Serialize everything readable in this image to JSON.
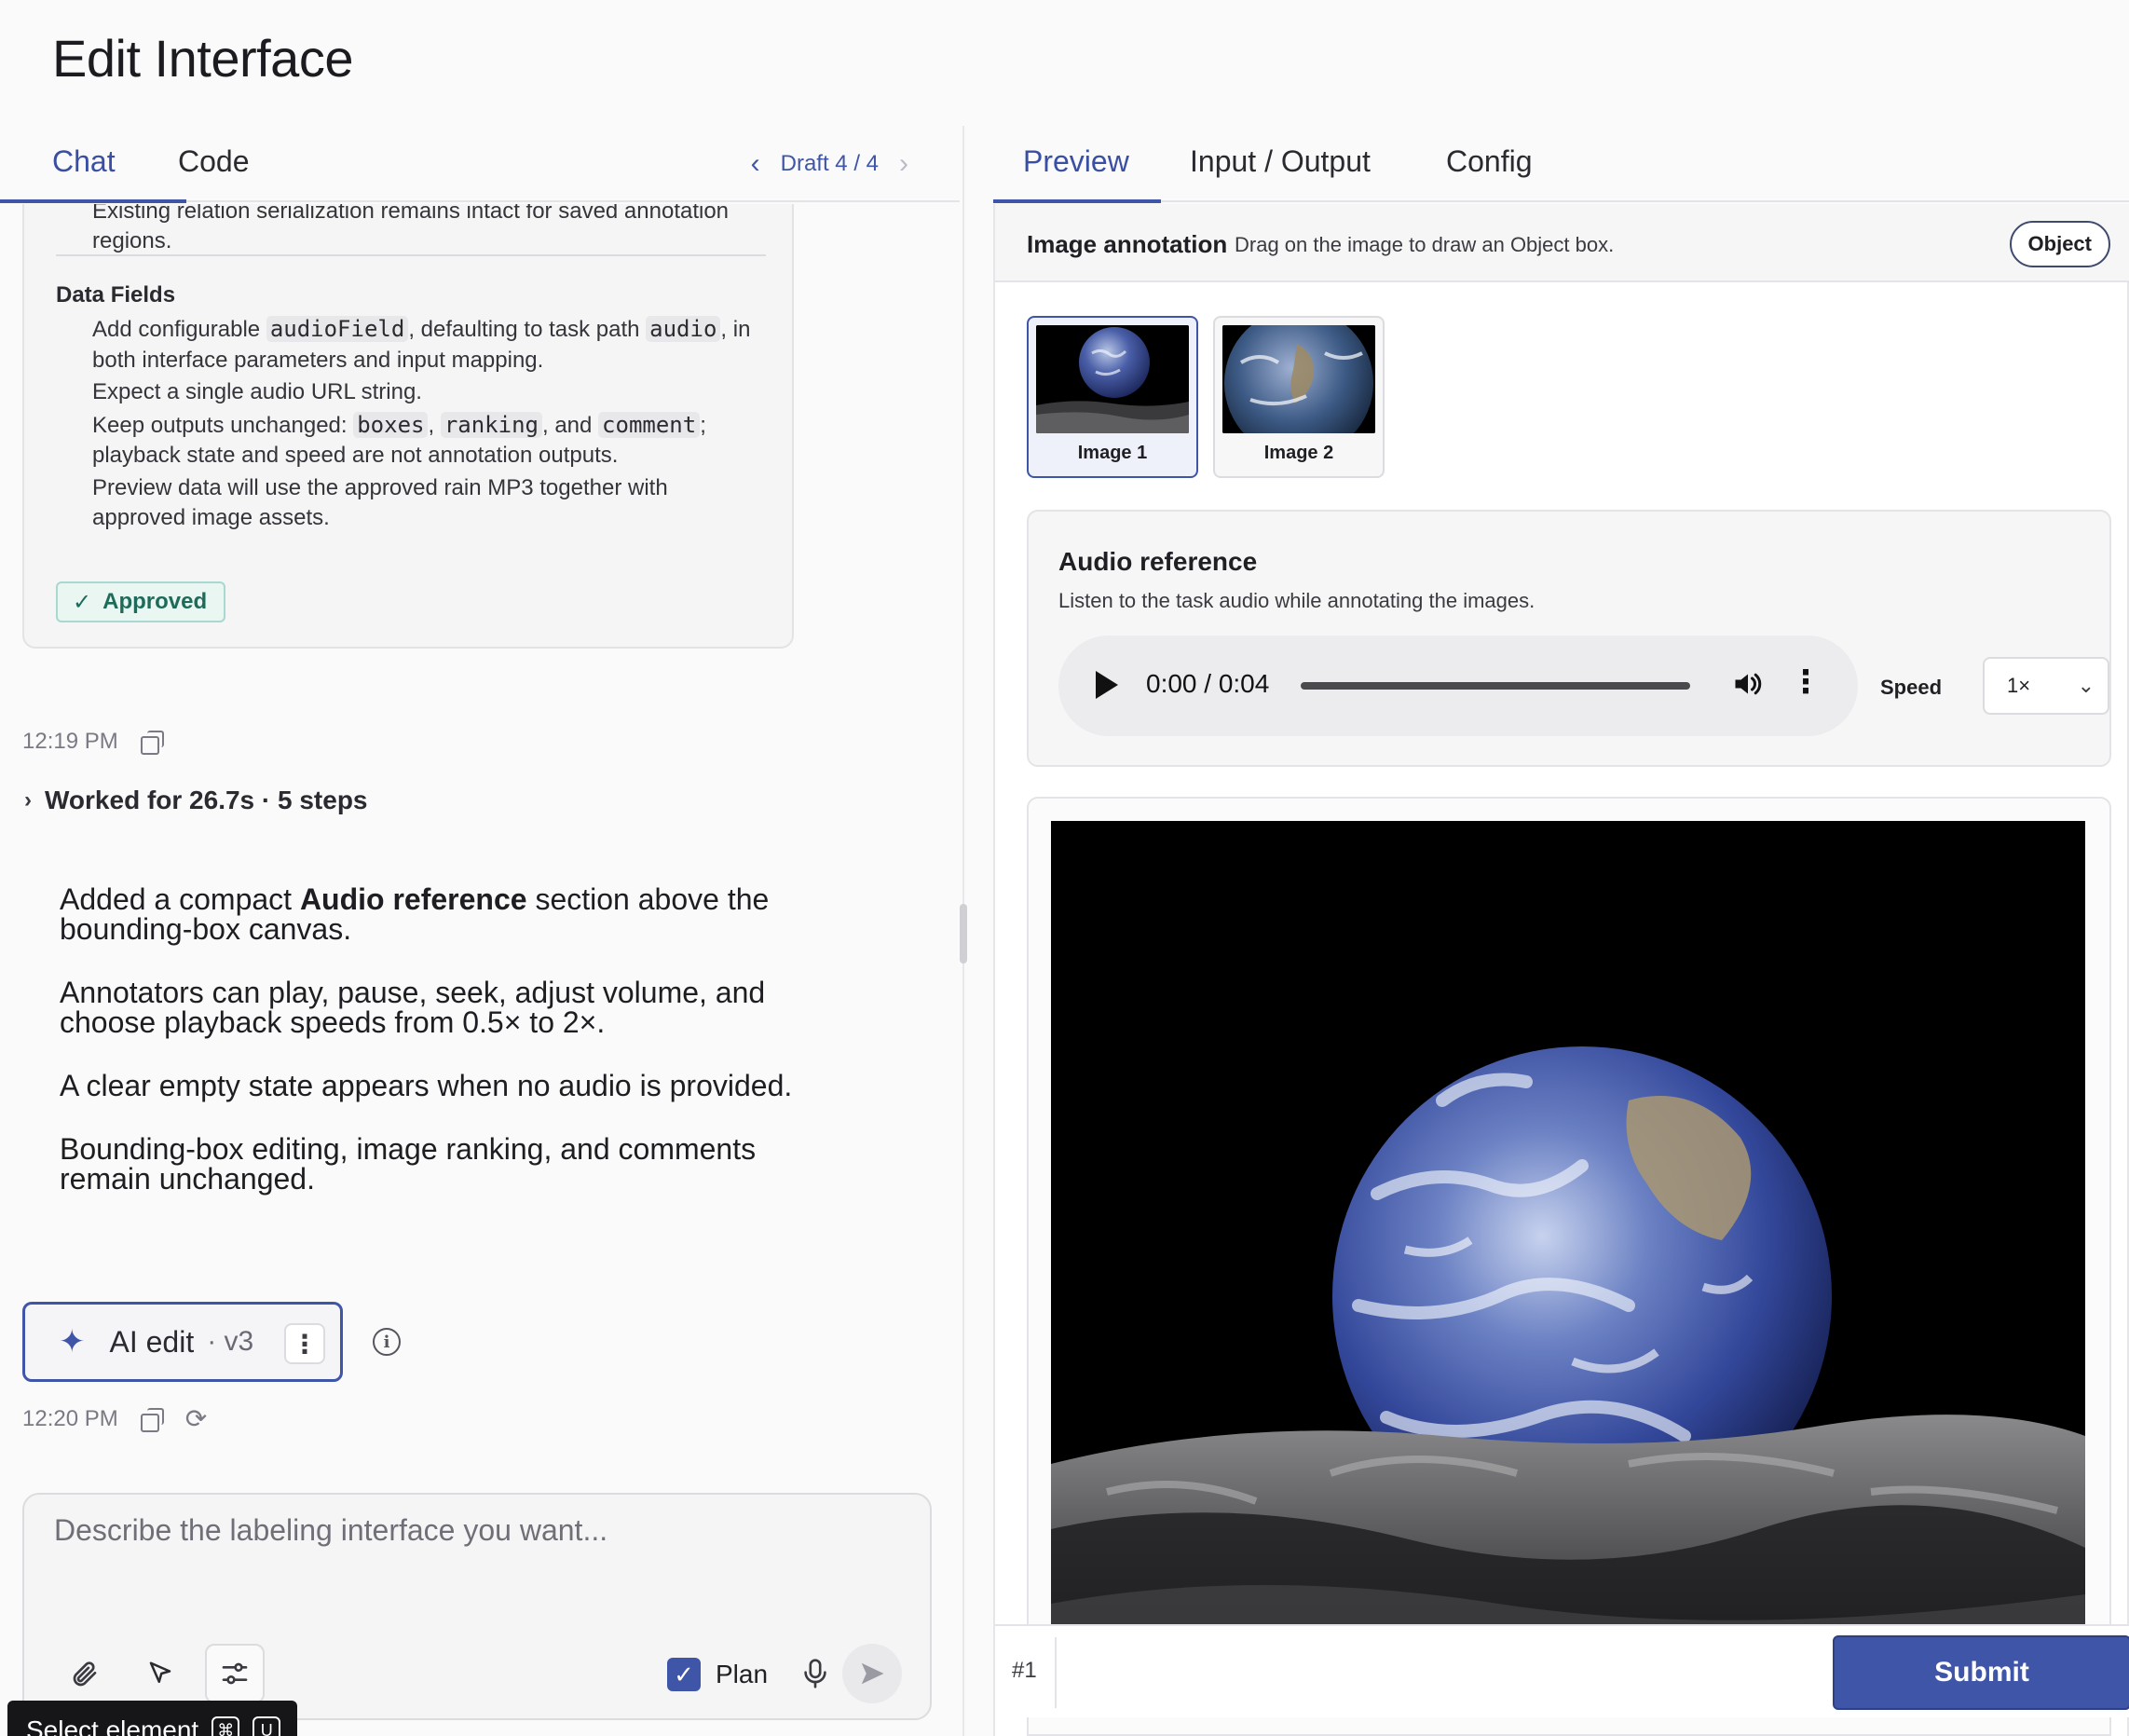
{
  "app": {
    "title": "Edit Interface"
  },
  "left_tabs": {
    "chat": "Chat",
    "code": "Code",
    "draft": "Draft 4 / 4",
    "prev_icon": "chevron-left-icon",
    "next_icon": "chevron-right-icon"
  },
  "plan_card": {
    "top_text": "Existing relation serialization remains intact for saved annotation regions.",
    "section_title": "Data Fields",
    "bullets": {
      "b1_pre": "Add configurable",
      "b1_code1": "audioField",
      "b1_mid": ", defaulting to task path",
      "b1_code2": "audio",
      "b1_post": ", in both interface parameters and input mapping.",
      "b2": "Expect a single audio URL string.",
      "b3_pre": "Keep outputs unchanged:",
      "b3_code1": "boxes",
      "b3_sep": ",",
      "b3_code2": "ranking",
      "b3_and": ", and",
      "b3_code3": "comment",
      "b3_post": "; playback state and speed are not annotation outputs.",
      "b4": "Preview data will use the approved rain MP3 together with approved image assets."
    },
    "approved_label": "Approved"
  },
  "messages": {
    "time_1": "12:19 PM",
    "worked": "Worked for 26.7s · 5 steps",
    "summary_p1_pre": "Added a compact ",
    "summary_p1_bold": "Audio reference",
    "summary_p1_post": " section above the bounding-box canvas.",
    "summary_p2": "Annotators can play, pause, seek, adjust volume, and choose playback speeds from 0.5× to 2×.",
    "summary_p3": "A clear empty state appears when no audio is provided.",
    "summary_p4": "Bounding-box editing, image ranking, and comments remain unchanged.",
    "ai_edit_label": "AI edit",
    "ai_edit_version": "· v3",
    "time_2": "12:20 PM"
  },
  "composer": {
    "placeholder": "Describe the labeling interface you want...",
    "plan_label": "Plan",
    "tooltip_label": "Select element",
    "tooltip_key1": "⌘",
    "tooltip_key2": "U"
  },
  "right_tabs": {
    "preview": "Preview",
    "io": "Input / Output",
    "config": "Config"
  },
  "preview": {
    "annot_title": "Image annotation",
    "annot_hint": "Drag on the image to draw an Object box.",
    "object_label": "Object",
    "thumbs": [
      {
        "label": "Image 1",
        "selected": true
      },
      {
        "label": "Image 2",
        "selected": false
      }
    ],
    "audio": {
      "title": "Audio reference",
      "subtitle": "Listen to the task audio while annotating the images.",
      "time": "0:00 / 0:04",
      "progress": 0,
      "speed_label": "Speed",
      "speed_value": "1×"
    },
    "item_number": "#1",
    "submit_label": "Submit"
  },
  "colors": {
    "accent": "#3f55a8",
    "approved_bg": "#eaf6f2",
    "approved_text": "#1e6b5a"
  }
}
